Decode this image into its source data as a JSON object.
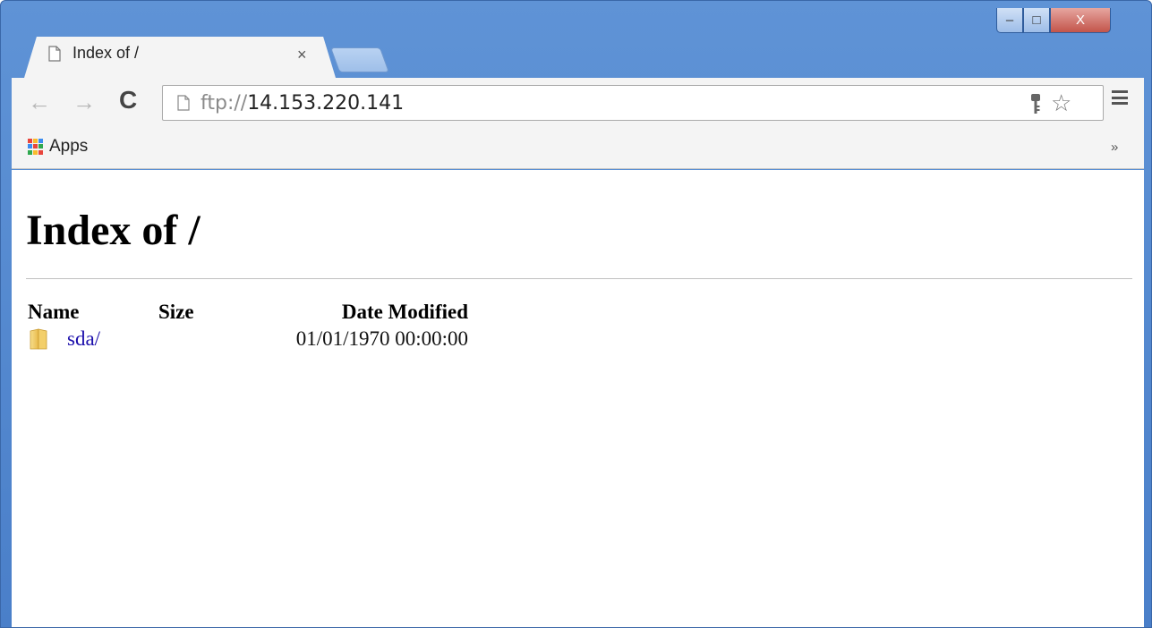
{
  "tab": {
    "title": "Index of /",
    "close_glyph": "×"
  },
  "window_controls": {
    "minimize": "–",
    "maximize": "□",
    "close": "X"
  },
  "toolbar": {
    "back_glyph": "←",
    "forward_glyph": "→",
    "reload_glyph": "C",
    "star_glyph": "☆"
  },
  "address": {
    "scheme": "ftp://",
    "host": "14.153.220.141"
  },
  "bookmarks": {
    "apps_label": "Apps",
    "more_glyph": "»"
  },
  "page": {
    "heading": "Index of /",
    "columns": {
      "name": "Name",
      "size": "Size",
      "date": "Date Modified"
    },
    "entries": [
      {
        "name": "sda/",
        "size": "",
        "date": "01/01/1970 00:00:00"
      }
    ]
  },
  "icons": [
    "page-icon",
    "close-icon",
    "back-icon",
    "forward-icon",
    "reload-icon",
    "key-icon",
    "star-icon",
    "menu-icon",
    "apps-icon",
    "folder-icon"
  ],
  "colors": {
    "frame": "#5f93d6",
    "link": "#1a0dab",
    "toolbar": "#f4f4f4"
  }
}
